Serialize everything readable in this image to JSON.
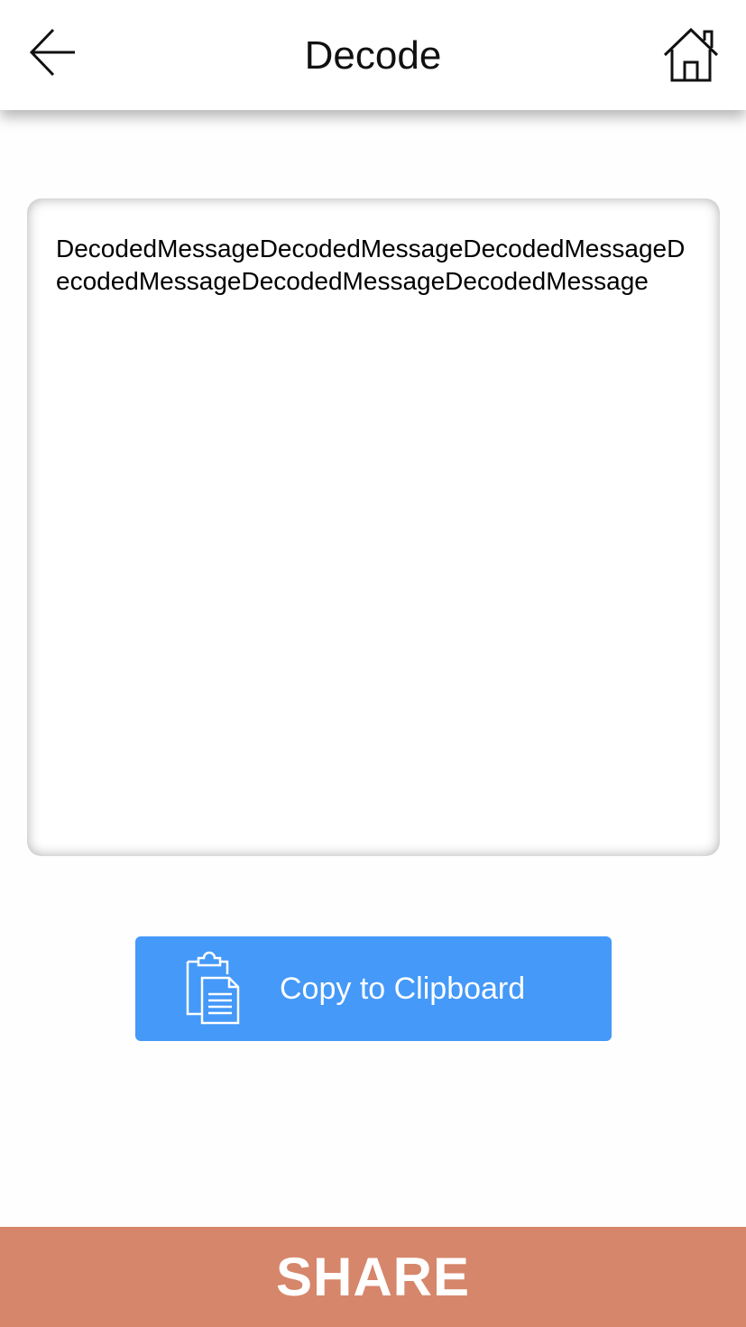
{
  "header": {
    "title": "Decode",
    "back_icon": "back-arrow-icon",
    "home_icon": "home-icon"
  },
  "message": {
    "text": "DecodedMessageDecodedMessageDecodedMessageDecodedMessageDecodedMessageDecodedMessage"
  },
  "copy_button": {
    "label": "Copy to Clipboard",
    "icon": "clipboard-icon",
    "color": "#4499f9"
  },
  "share_button": {
    "label": "SHARE",
    "color": "#d6866a"
  }
}
